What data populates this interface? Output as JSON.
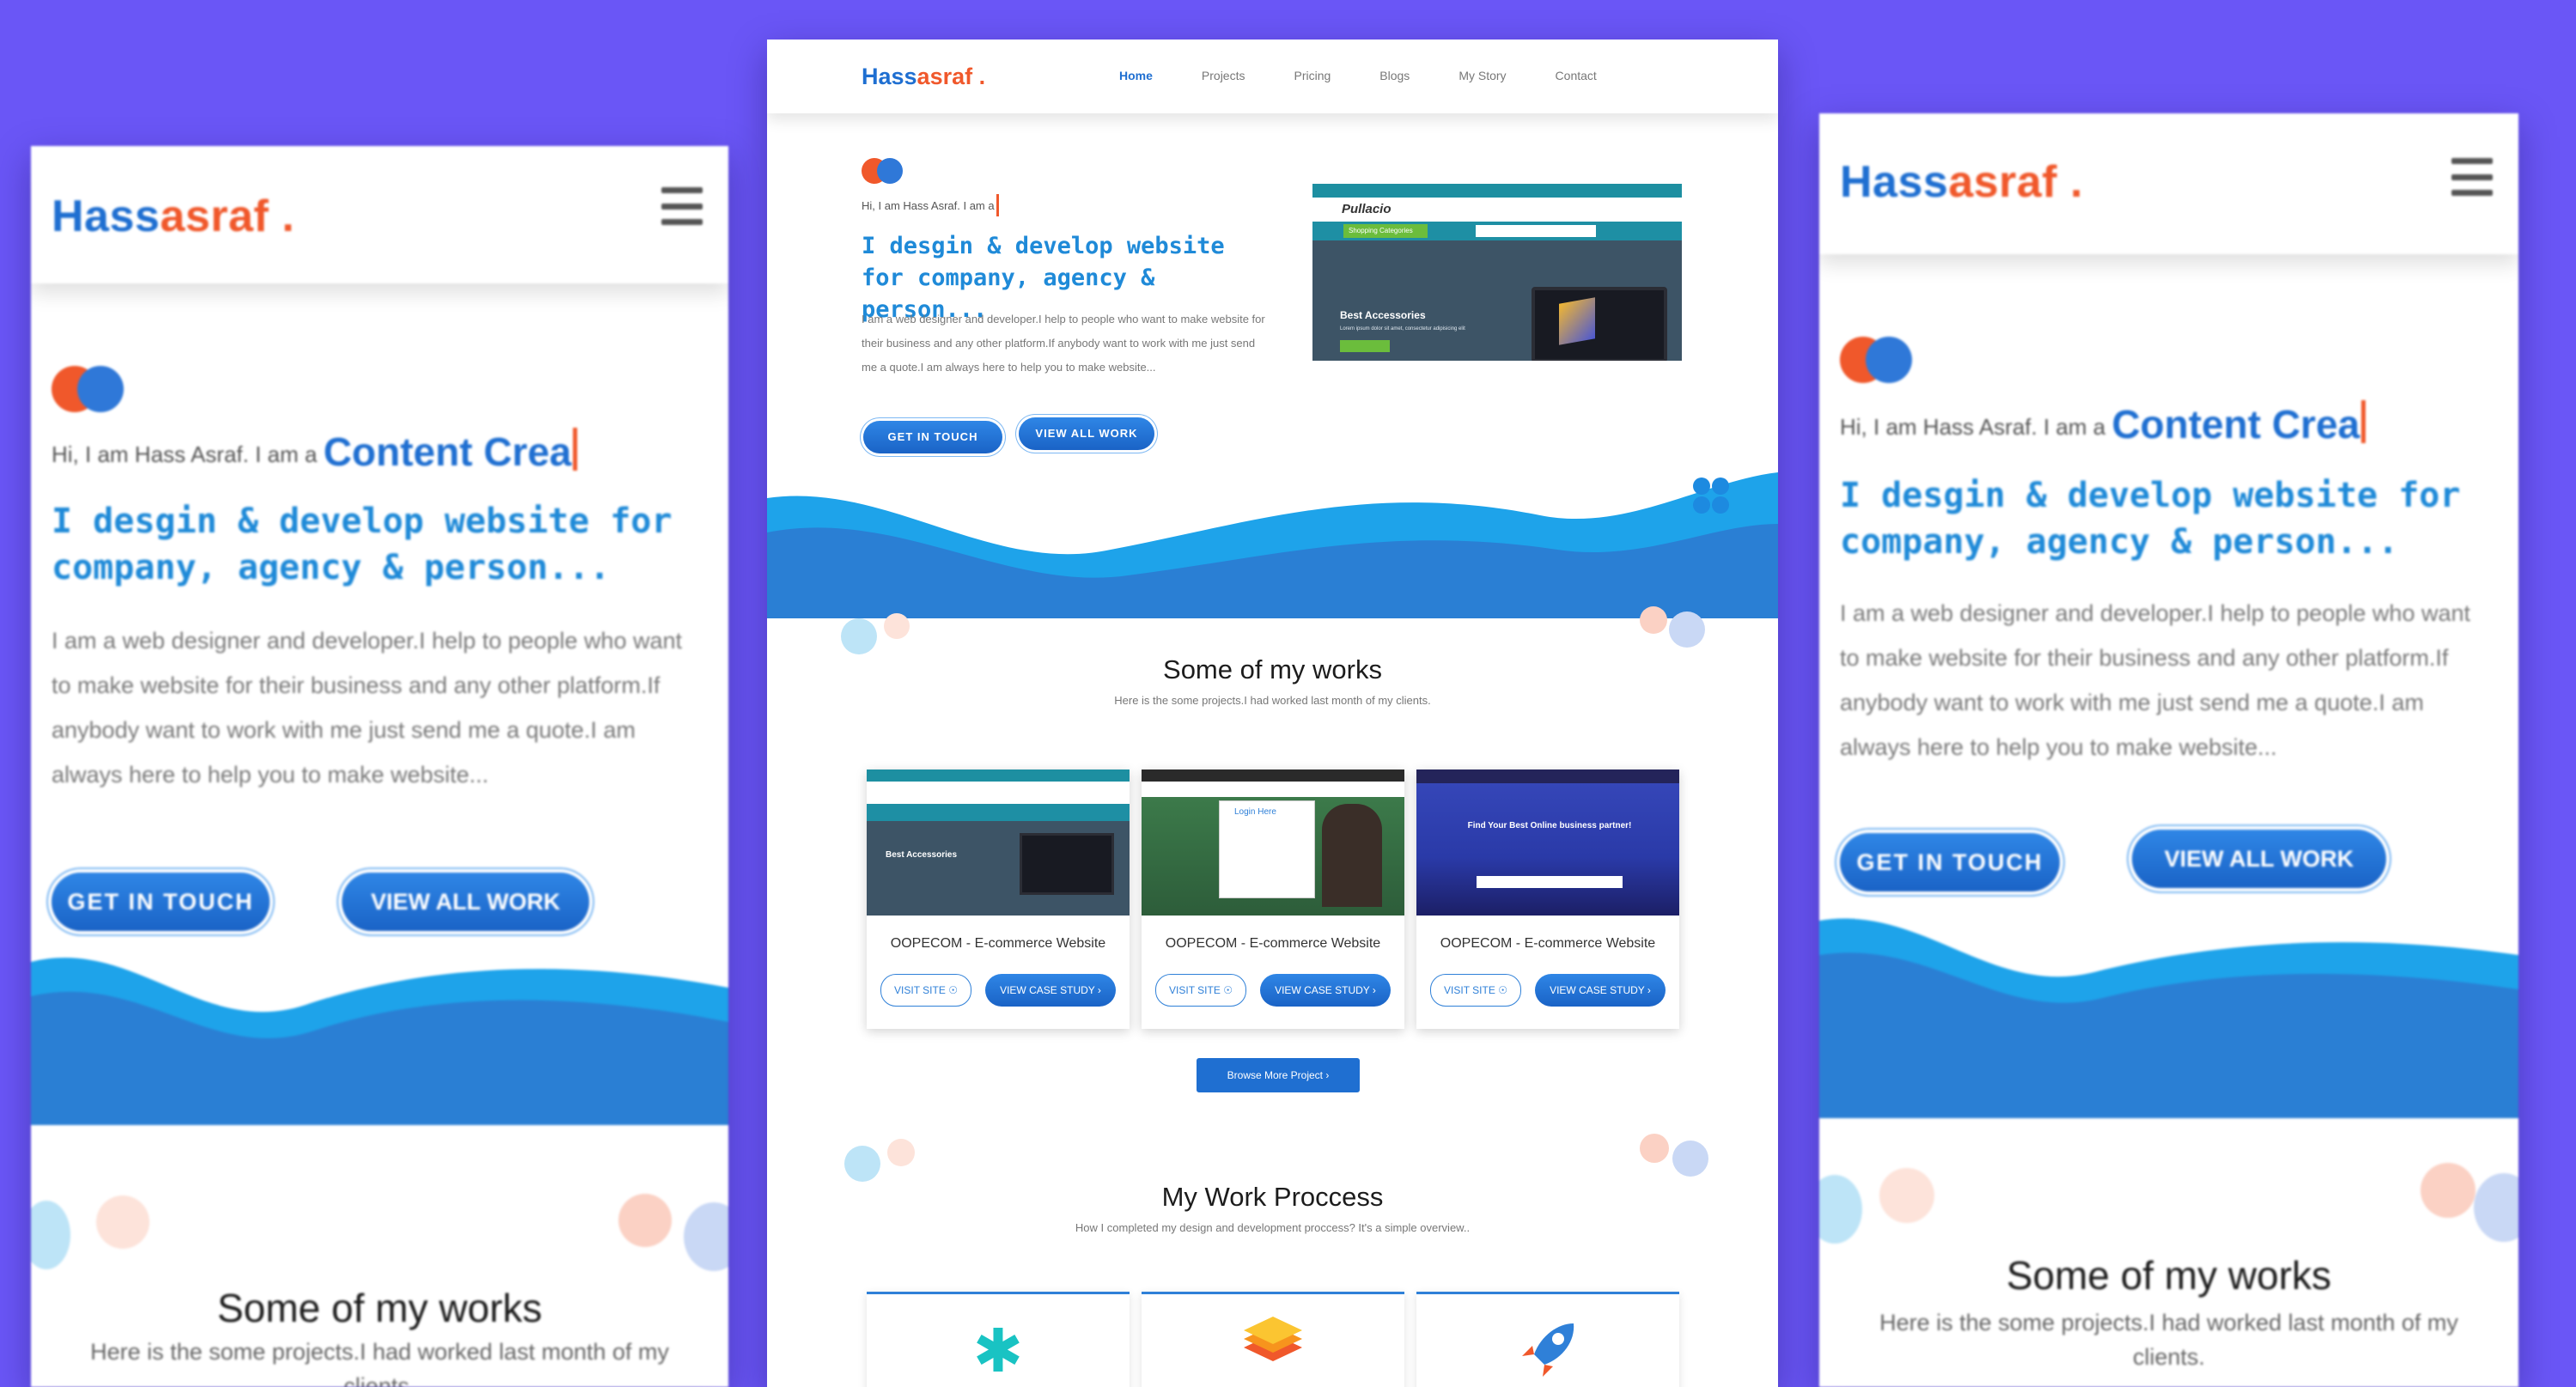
{
  "brand": {
    "part1": "Hass",
    "part2": "asraf",
    "dot": "."
  },
  "colors": {
    "background": "#6a56f6",
    "primary": "#1f6fd1",
    "accent": "#f0582b",
    "wave": "#1f8ad8"
  },
  "nav": {
    "items": [
      "Home",
      "Projects",
      "Pricing",
      "Blogs",
      "My Story",
      "Contact"
    ],
    "active": "Home"
  },
  "hero": {
    "intro": "Hi, I am Hass Asraf. I am a",
    "typed": "Content Crea",
    "headline": "I desgin & develop website for company, agency & person...",
    "paragraph": "I am a web designer and developer.I help to people who want to make website for their business and any other platform.If anybody want to work with me just send me a quote.I am always here to help you to make website...",
    "cta_primary": "GET IN TOUCH",
    "cta_secondary": "VIEW ALL WORK"
  },
  "hero_screenshot": {
    "logo": "Pullacio",
    "category": "Shopping Categories",
    "title": "Best Accessories",
    "subtitle": "Lorem ipsum dolor sit amet, consectetur adipisicing elit"
  },
  "works": {
    "title": "Some of my works",
    "subtitle": "Here is the some projects.I had worked last month of my clients.",
    "cards": [
      {
        "name": "OOPECOM - E-commerce Website",
        "visit": "VISIT SITE",
        "case": "VIEW CASE STUDY",
        "shot_text": "Best Accessories"
      },
      {
        "name": "OOPECOM - E-commerce Website",
        "visit": "VISIT SITE",
        "case": "VIEW CASE STUDY",
        "shot_text": "Login Here"
      },
      {
        "name": "OOPECOM - E-commerce Website",
        "visit": "VISIT SITE",
        "case": "VIEW CASE STUDY",
        "shot_text": "Find Your Best Online business partner!"
      }
    ],
    "browse": "Browse More Project"
  },
  "process": {
    "title": "My Work Proccess",
    "subtitle": "How I completed my design and development proccess? It's a simple overview..",
    "icons": [
      "puzzle-icon",
      "layers-icon",
      "rocket-icon"
    ]
  }
}
